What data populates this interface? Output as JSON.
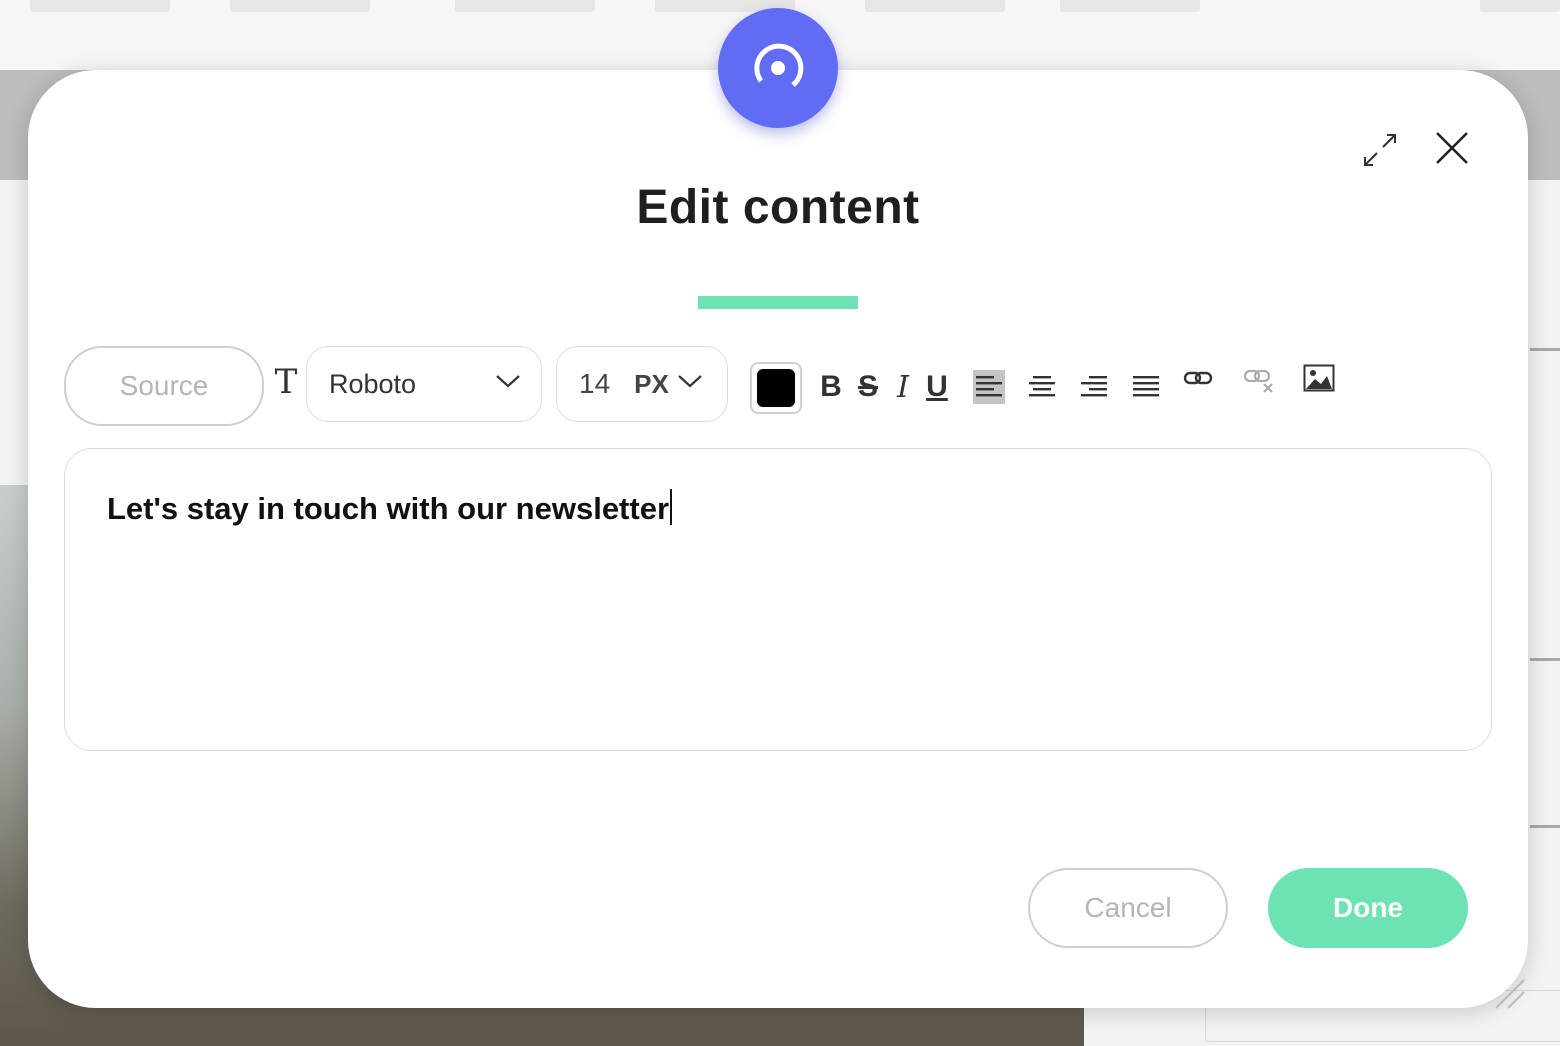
{
  "modal": {
    "title": "Edit content",
    "logo_icon": "target-icon",
    "expand_icon": "expand-icon",
    "close_icon": "close-icon"
  },
  "toolbar": {
    "source_label": "Source",
    "font_icon": "font-type-icon",
    "font_family": "Roboto",
    "font_size": "14",
    "font_unit": "PX",
    "text_color": "#000000",
    "bold_label": "B",
    "strike_label": "S",
    "italic_label": "I",
    "underline_label": "U",
    "align_left_icon": "align-left-icon",
    "align_center_icon": "align-center-icon",
    "align_right_icon": "align-right-icon",
    "align_justify_icon": "align-justify-icon",
    "link_icon": "link-icon",
    "unlink_icon": "unlink-icon",
    "image_icon": "image-icon"
  },
  "editor": {
    "content": "Let's stay in touch with our newsletter"
  },
  "footer": {
    "cancel_label": "Cancel",
    "done_label": "Done"
  },
  "colors": {
    "accent": "#6de2b3",
    "brand": "#5f6cf3"
  }
}
